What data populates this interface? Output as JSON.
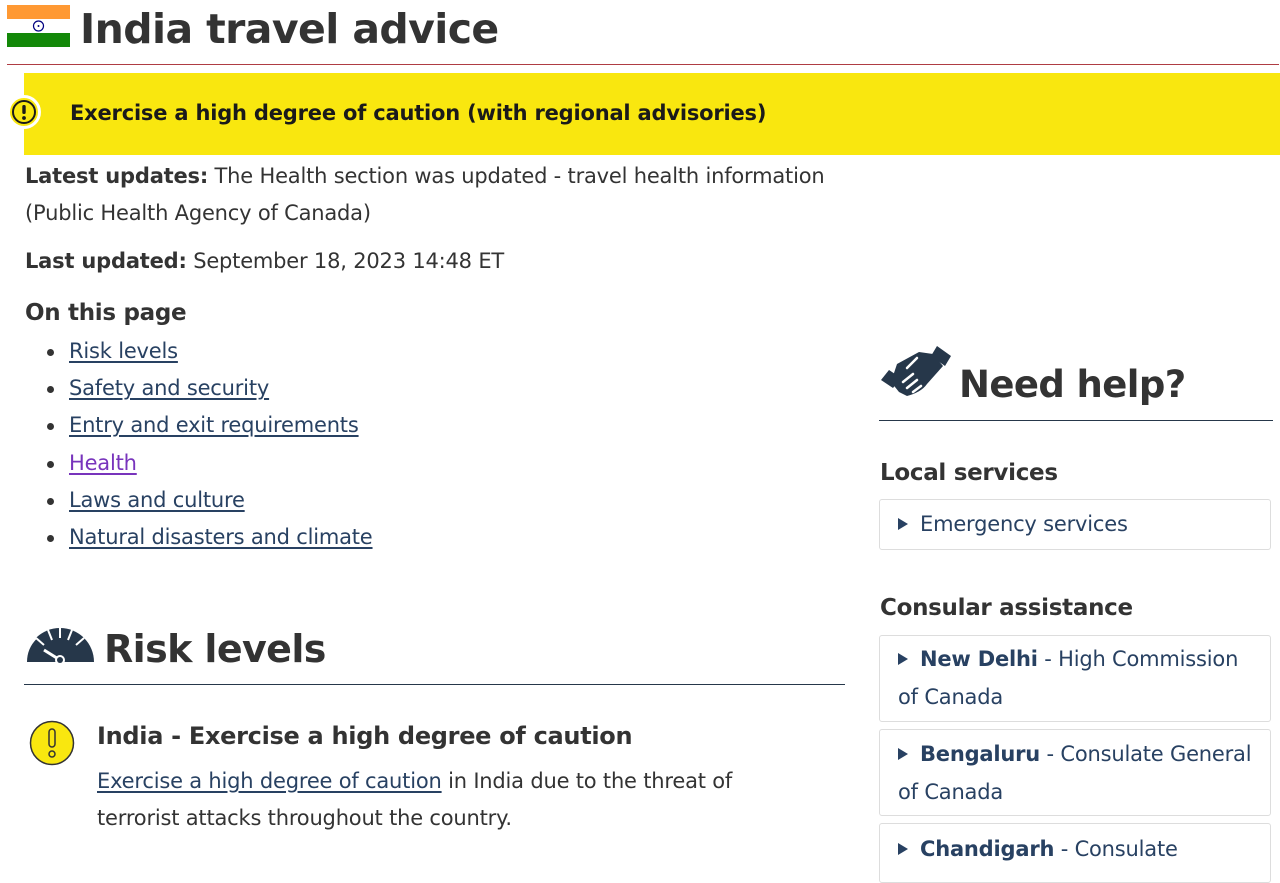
{
  "page": {
    "title": "India travel advice",
    "flag_icon": "india-flag-icon"
  },
  "advisory": {
    "icon": "warning-exclamation-icon",
    "text": "Exercise a high degree of caution (with regional advisories)",
    "color": "#f9e70f"
  },
  "updates": {
    "latest_label": "Latest updates:",
    "latest_text": "The Health section was updated - travel health information (Public Health Agency of Canada)",
    "last_label": "Last updated:",
    "last_value": "September 18, 2023 14:48 ET"
  },
  "on_this_page": {
    "heading": "On this page",
    "items": [
      {
        "label": "Risk levels"
      },
      {
        "label": "Safety and security"
      },
      {
        "label": "Entry and exit requirements"
      },
      {
        "label": "Health"
      },
      {
        "label": "Laws and culture"
      },
      {
        "label": "Natural disasters and climate"
      }
    ]
  },
  "risk_levels": {
    "icon": "gauge-icon",
    "heading": "Risk levels",
    "level_icon": "warning-exclamation-icon",
    "subheading": "India - Exercise a high degree of caution",
    "link_text": "Exercise a high degree of caution",
    "paragraph_rest": "in India due to the threat of terrorist attacks throughout the country."
  },
  "help": {
    "icon": "handshake-icon",
    "heading": "Need help?",
    "local_heading": "Local services",
    "local_items": [
      {
        "label": "Emergency services"
      }
    ],
    "consular_heading": "Consular assistance",
    "consular_items": [
      {
        "city": "New Delhi",
        "office_line1": "- High Commission",
        "office_line2": "of Canada"
      },
      {
        "city": "Bengaluru",
        "office_line1": "- Consulate General",
        "office_line2": "of Canada"
      },
      {
        "city": "Chandigarh",
        "office_line1": "- Consulate",
        "office_line2": ""
      }
    ]
  },
  "colors": {
    "link": "#284162",
    "visited_link": "#7834bc",
    "title_rule": "#af3c43",
    "section_rule": "#26374a",
    "text": "#333333"
  }
}
